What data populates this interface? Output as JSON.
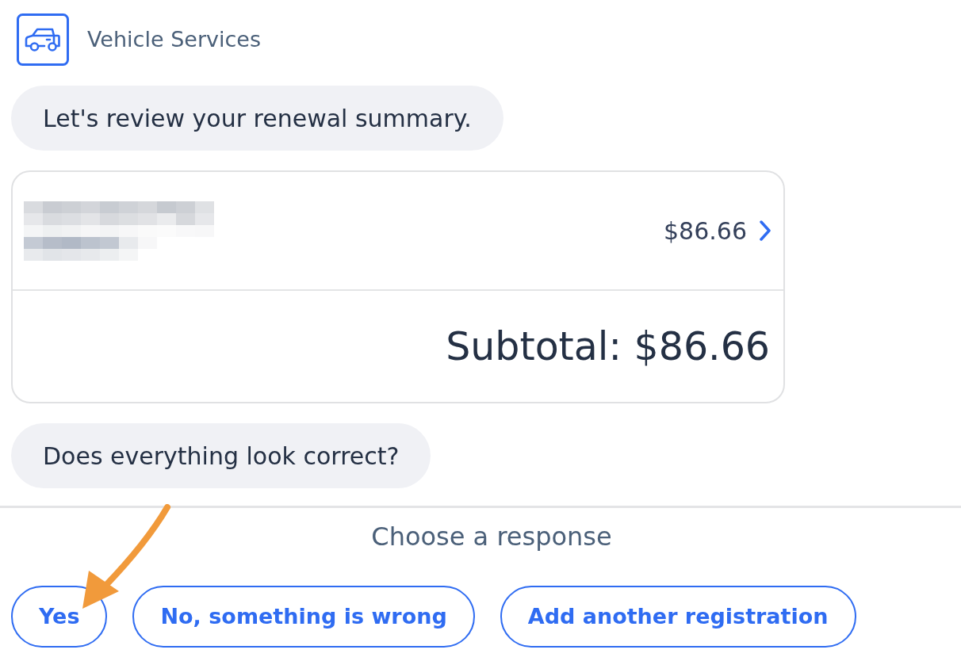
{
  "header": {
    "title": "Vehicle Services"
  },
  "messages": [
    {
      "kind": "bubble",
      "text": "Let's review your renewal summary."
    },
    {
      "kind": "summary_card",
      "items": [
        {
          "amount": "$86.66"
        }
      ],
      "subtotal": "Subtotal: $86.66"
    },
    {
      "kind": "bubble",
      "text": "Does everything look correct?"
    }
  ],
  "response_panel": {
    "prompt": "Choose a response",
    "options": [
      "Yes",
      "No, something is wrong",
      "Add another registration"
    ]
  }
}
